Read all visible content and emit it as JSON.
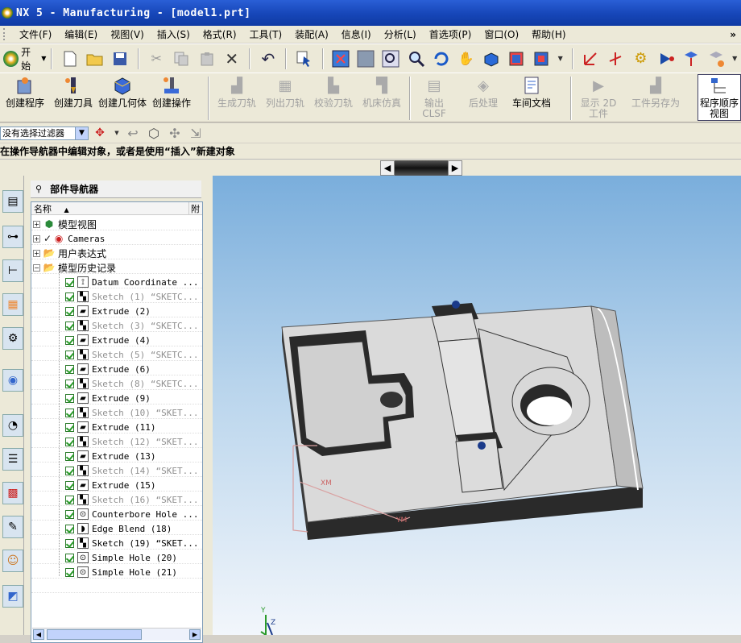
{
  "window": {
    "title": "NX 5 - Manufacturing - [model1.prt]"
  },
  "menu": {
    "items": [
      "文件(F)",
      "编辑(E)",
      "视图(V)",
      "插入(S)",
      "格式(R)",
      "工具(T)",
      "装配(A)",
      "信息(I)",
      "分析(L)",
      "首选项(P)",
      "窗口(O)",
      "帮助(H)"
    ]
  },
  "toolbar": {
    "start_label": "开始"
  },
  "operations": {
    "create_program": "创建程序",
    "create_tool": "创建刀具",
    "create_geometry": "创建几何体",
    "create_operation": "创建操作",
    "generate_path": "生成刀轨",
    "list_path": "列出刀轨",
    "verify_path": "校验刀轨",
    "machine_sim": "机床仿真",
    "output_clsf": "输出 CLSF",
    "postprocess": "后处理",
    "shop_doc": "车间文档",
    "show_2d": "显示 2D 工件",
    "save_part": "工件另存为",
    "program_order": "程序顺序视图"
  },
  "selection": {
    "filter": "没有选择过滤器"
  },
  "cue": {
    "text": "在操作导航器中编辑对象，或者是使用“插入”新建对象"
  },
  "navigator": {
    "title": "部件导航器",
    "col_name": "名称",
    "col_short": "附",
    "top_items": [
      "模型视图",
      "Cameras",
      "用户表达式",
      "模型历史记录"
    ],
    "features": [
      {
        "label": "Datum Coordinate ...",
        "icon": "datum-csys-icon",
        "grey": false
      },
      {
        "label": "Sketch (1) “SKETC...",
        "icon": "sketch-icon",
        "grey": true
      },
      {
        "label": "Extrude (2)",
        "icon": "extrude-icon",
        "grey": false
      },
      {
        "label": "Sketch (3) “SKETC...",
        "icon": "sketch-icon",
        "grey": true
      },
      {
        "label": "Extrude (4)",
        "icon": "extrude-icon",
        "grey": false
      },
      {
        "label": "Sketch (5) “SKETC...",
        "icon": "sketch-icon",
        "grey": true
      },
      {
        "label": "Extrude (6)",
        "icon": "extrude-icon",
        "grey": false
      },
      {
        "label": "Sketch (8) “SKETC...",
        "icon": "sketch-icon",
        "grey": true
      },
      {
        "label": "Extrude (9)",
        "icon": "extrude-icon",
        "grey": false
      },
      {
        "label": "Sketch (10) “SKET...",
        "icon": "sketch-icon",
        "grey": true
      },
      {
        "label": "Extrude (11)",
        "icon": "extrude-icon",
        "grey": false
      },
      {
        "label": "Sketch (12) “SKET...",
        "icon": "sketch-icon",
        "grey": true
      },
      {
        "label": "Extrude (13)",
        "icon": "extrude-icon",
        "grey": false
      },
      {
        "label": "Sketch (14) “SKET...",
        "icon": "sketch-icon",
        "grey": true
      },
      {
        "label": "Extrude (15)",
        "icon": "extrude-icon",
        "grey": false
      },
      {
        "label": "Sketch (16) “SKET...",
        "icon": "sketch-icon",
        "grey": true
      },
      {
        "label": "Counterbore Hole ...",
        "icon": "hole-icon",
        "grey": false
      },
      {
        "label": "Edge Blend (18)",
        "icon": "blend-icon",
        "grey": false
      },
      {
        "label": "Sketch (19) “SKET...",
        "icon": "sketch-icon",
        "grey": false
      },
      {
        "label": "Simple Hole (20)",
        "icon": "hole-icon",
        "grey": false
      },
      {
        "label": "Simple Hole (21)",
        "icon": "hole-icon",
        "grey": false
      }
    ]
  },
  "viewport": {
    "axis_y": "Y",
    "axis_z": "Z",
    "axis_xm": "XM",
    "axis_ym": "YM"
  },
  "colors": {
    "titlebar": "#1646b8",
    "accent_green": "#2a9a2a",
    "part_grey": "#d9d9d9"
  }
}
